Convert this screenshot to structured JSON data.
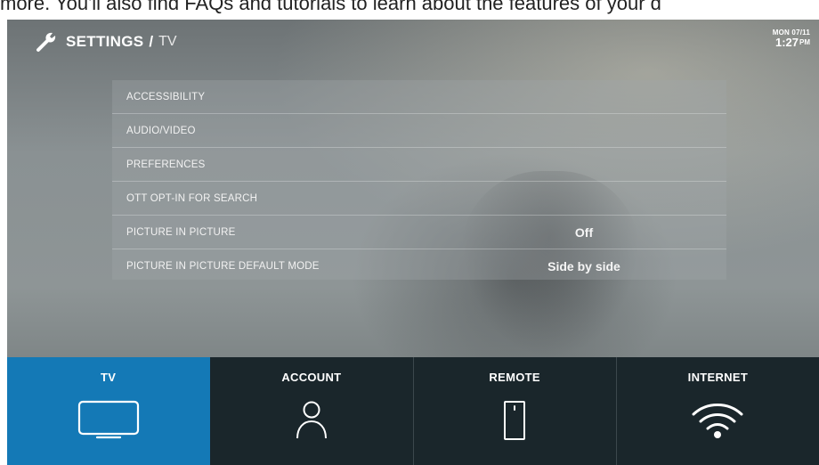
{
  "top_strip": {
    "text": "more. You'll also find FAQs and tutorials to learn about the features of your d"
  },
  "header": {
    "title": "SETTINGS",
    "separator": "/",
    "subtitle": "TV",
    "icon": "wrench-icon"
  },
  "clock": {
    "date": "MON 07/11",
    "time": "1:27",
    "ampm": "PM"
  },
  "menu": {
    "items": [
      {
        "label": "ACCESSIBILITY",
        "value": ""
      },
      {
        "label": "AUDIO/VIDEO",
        "value": ""
      },
      {
        "label": "PREFERENCES",
        "value": ""
      },
      {
        "label": "OTT OPT-IN FOR SEARCH",
        "value": ""
      },
      {
        "label": "PICTURE IN PICTURE",
        "value": "Off"
      },
      {
        "label": "PICTURE IN PICTURE DEFAULT MODE",
        "value": "Side by side"
      }
    ]
  },
  "tabs": [
    {
      "label": "TV",
      "icon": "tv-icon",
      "active": true
    },
    {
      "label": "ACCOUNT",
      "icon": "person-icon",
      "active": false
    },
    {
      "label": "REMOTE",
      "icon": "remote-icon",
      "active": false
    },
    {
      "label": "INTERNET",
      "icon": "wifi-icon",
      "active": false
    }
  ],
  "colors": {
    "active_tab": "#1479b6",
    "tab_bar": "#1a262b",
    "text": "#ffffff"
  }
}
